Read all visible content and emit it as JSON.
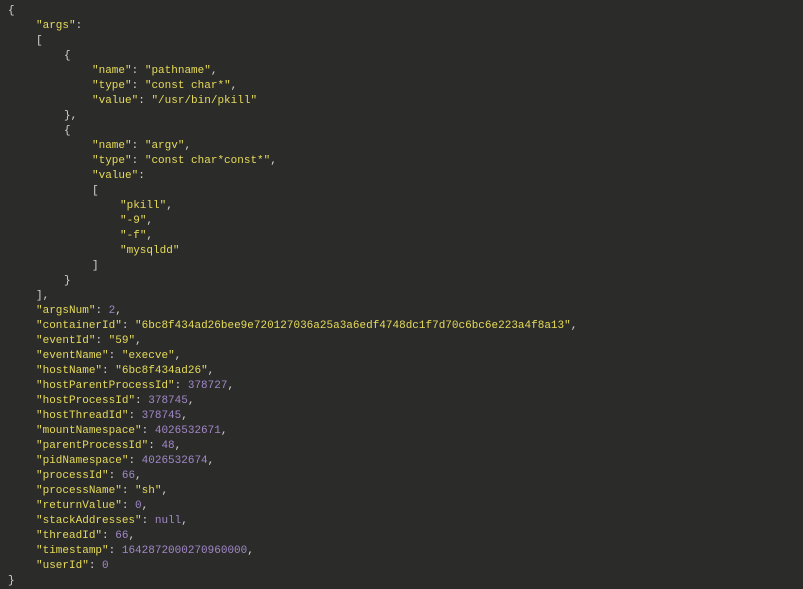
{
  "json": {
    "args": [
      {
        "name": "pathname",
        "type": "const char*",
        "value": "/usr/bin/pkill"
      },
      {
        "name": "argv",
        "type": "const char*const*",
        "value": [
          "pkill",
          "-9",
          "-f",
          "mysqldd"
        ]
      }
    ],
    "argsNum": 2,
    "containerId": "6bc8f434ad26bee9e720127036a25a3a6edf4748dc1f7d70c6bc6e223a4f8a13",
    "eventId": "59",
    "eventName": "execve",
    "hostName": "6bc8f434ad26",
    "hostParentProcessId": 378727,
    "hostProcessId": 378745,
    "hostThreadId": 378745,
    "mountNamespace": 4026532671,
    "parentProcessId": 48,
    "pidNamespace": 4026532674,
    "processId": 66,
    "processName": "sh",
    "returnValue": 0,
    "stackAddresses": null,
    "threadId": 66,
    "timestamp": 1642872000270960254,
    "userId": 0
  },
  "labels": {
    "args": "args",
    "name": "name",
    "type": "type",
    "value": "value",
    "argsNum": "argsNum",
    "containerId": "containerId",
    "eventId": "eventId",
    "eventName": "eventName",
    "hostName": "hostName",
    "hostParentProcessId": "hostParentProcessId",
    "hostProcessId": "hostProcessId",
    "hostThreadId": "hostThreadId",
    "mountNamespace": "mountNamespace",
    "parentProcessId": "parentProcessId",
    "pidNamespace": "pidNamespace",
    "processId": "processId",
    "processName": "processName",
    "returnValue": "returnValue",
    "stackAddresses": "stackAddresses",
    "threadId": "threadId",
    "timestamp": "timestamp",
    "userId": "userId",
    "nullText": "null"
  }
}
